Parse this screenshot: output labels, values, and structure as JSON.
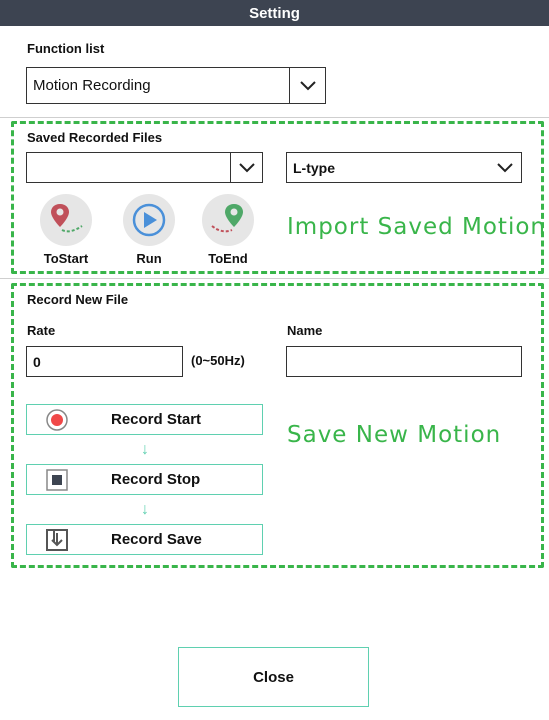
{
  "window": {
    "title": "Setting"
  },
  "function_list": {
    "label": "Function list",
    "selected": "Motion Recording"
  },
  "saved_files": {
    "label": "Saved Recorded Files",
    "file_select_value": "",
    "type_select_value": "L-type",
    "buttons": [
      {
        "label": "ToStart",
        "icon": "pin-to-start-icon"
      },
      {
        "label": "Run",
        "icon": "play-icon"
      },
      {
        "label": "ToEnd",
        "icon": "pin-to-end-icon"
      }
    ],
    "annotation": "Import Saved Motion"
  },
  "record_new": {
    "label": "Record New File",
    "rate_label": "Rate",
    "rate_value": "0",
    "rate_range": "(0~50Hz)",
    "name_label": "Name",
    "name_value": "",
    "buttons": [
      {
        "label": "Record Start",
        "icon": "record-icon"
      },
      {
        "label": "Record Stop",
        "icon": "stop-icon"
      },
      {
        "label": "Record Save",
        "icon": "save-icon"
      }
    ],
    "annotation": "Save New Motion"
  },
  "footer": {
    "close_label": "Close"
  },
  "colors": {
    "titlebar": "#3d4451",
    "annotation_green": "#39b54a",
    "button_border": "#5fd0b0",
    "record_red": "#f04848",
    "pin_red": "#c0505a",
    "pin_green": "#4fa868",
    "play_blue": "#4a90d9"
  }
}
